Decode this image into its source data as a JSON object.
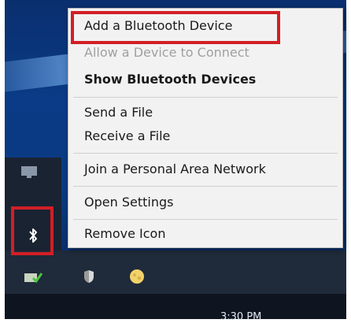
{
  "menu": {
    "items": [
      {
        "label": "Add a Bluetooth Device",
        "state": "normal"
      },
      {
        "label": "Allow a Device to Connect",
        "state": "disabled"
      },
      {
        "label": "Show Bluetooth Devices",
        "state": "bold"
      },
      {
        "label": "Send a File",
        "state": "normal"
      },
      {
        "label": "Receive a File",
        "state": "normal"
      },
      {
        "label": "Join a Personal Area Network",
        "state": "normal"
      },
      {
        "label": "Open Settings",
        "state": "normal"
      },
      {
        "label": "Remove Icon",
        "state": "normal"
      }
    ]
  },
  "tray": {
    "icons": [
      "monitor-icon",
      "bluetooth-icon",
      "network-icon",
      "shield-icon",
      "weather-icon"
    ]
  },
  "taskbar": {
    "clock": "3:30 PM"
  },
  "colors": {
    "highlight": "#d21f26",
    "menu_bg": "#f2f2f2",
    "desktop": "#0b3a86"
  }
}
